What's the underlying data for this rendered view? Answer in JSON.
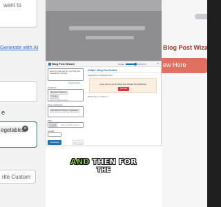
{
  "left_background": {
    "snippet_top": "want to",
    "link": "Generate with AI",
    "label_e": "e",
    "chip_label": "egetables",
    "custom_button": "rite Custom"
  },
  "right_background": {
    "title": "Blog Post Wizard To",
    "button": "ew Here"
  },
  "modal": {
    "title": "Blog Post Wizard",
    "slider_label": "Output",
    "slider_value_fraction": 0.45,
    "close": "×",
    "input_placeholder": "Enter the main topic for your blog post, separated by commas",
    "suggestions_link": "Suggest topics",
    "audience_label": "Audience",
    "audience_tags": [
      "Business Audience",
      "Youtube"
    ],
    "audience_more": "Select or Write Custom",
    "tone_label": "Tone of Voice(s)",
    "tone_tags": [
      "Best Meal for Grocery Vegetables"
    ],
    "tone_more": "",
    "style_label": "Style",
    "style_tags": [
      "Formal"
    ],
    "style_more": "Select or Write Custom",
    "length_label": "Length",
    "generate_button": "Generate",
    "save_button": "Save Post",
    "output_title": "Output - Blog Post Outline",
    "output_subtitle": "Suggestions will appear here",
    "promo_text": "Learn How to use the Blog Post Wizard Tool (Machine)",
    "promo_button": "Get Now",
    "word_count": "Word Count = 0 Chars: 0"
  },
  "caption": {
    "highlight": "AND",
    "line1_rest": "THEN FOR",
    "line2": "THE"
  },
  "colors": {
    "accent": "#2271b1",
    "promo_button": "#dc3545",
    "caption_highlight": "#9be33a",
    "bg_right_button": "#e0705f"
  }
}
